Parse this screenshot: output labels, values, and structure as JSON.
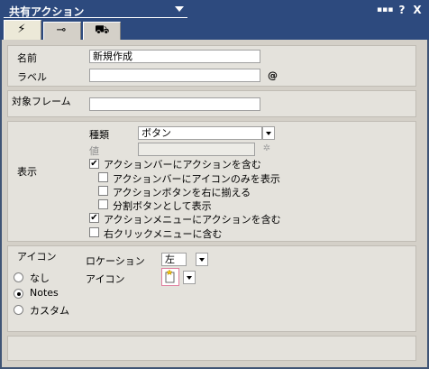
{
  "window": {
    "title": "共有アクション",
    "btn_dots": "▪▪▪",
    "btn_help": "?",
    "btn_close": "X"
  },
  "tabs": [
    {
      "name": "basics",
      "glyph": "⚡"
    },
    {
      "name": "advanced",
      "glyph": "⊸"
    },
    {
      "name": "sharing",
      "glyph": "⛟"
    }
  ],
  "basic": {
    "name_label": "名前",
    "name_value": "新規作成",
    "label_label": "ラベル",
    "label_value": "",
    "at_symbol": "@"
  },
  "target": {
    "label": "対象フレーム",
    "value": ""
  },
  "display": {
    "section_label": "表示",
    "type_label": "種類",
    "type_value": "ボタン",
    "value_label": "値",
    "value_value": "",
    "checkboxes": [
      {
        "label": "アクションバーにアクションを含む",
        "checked": true
      },
      {
        "label": "アクションバーにアイコンのみを表示",
        "checked": false
      },
      {
        "label": "アクションボタンを右に揃える",
        "checked": false
      },
      {
        "label": "分割ボタンとして表示",
        "checked": false
      },
      {
        "label": "アクションメニューにアクションを含む",
        "checked": true
      },
      {
        "label": "右クリックメニューに含む",
        "checked": false
      }
    ]
  },
  "icon": {
    "section_label": "アイコン",
    "radios": [
      {
        "label": "なし",
        "selected": false
      },
      {
        "label": "Notes",
        "selected": true
      },
      {
        "label": "カスタム",
        "selected": false
      }
    ],
    "location_label": "ロケーション",
    "location_value": "左",
    "icon_label": "アイコン"
  },
  "colors": {
    "titlebar": "#2d4a7e",
    "panel": "#e4e2dc",
    "window_bg": "#d4d0c8"
  }
}
